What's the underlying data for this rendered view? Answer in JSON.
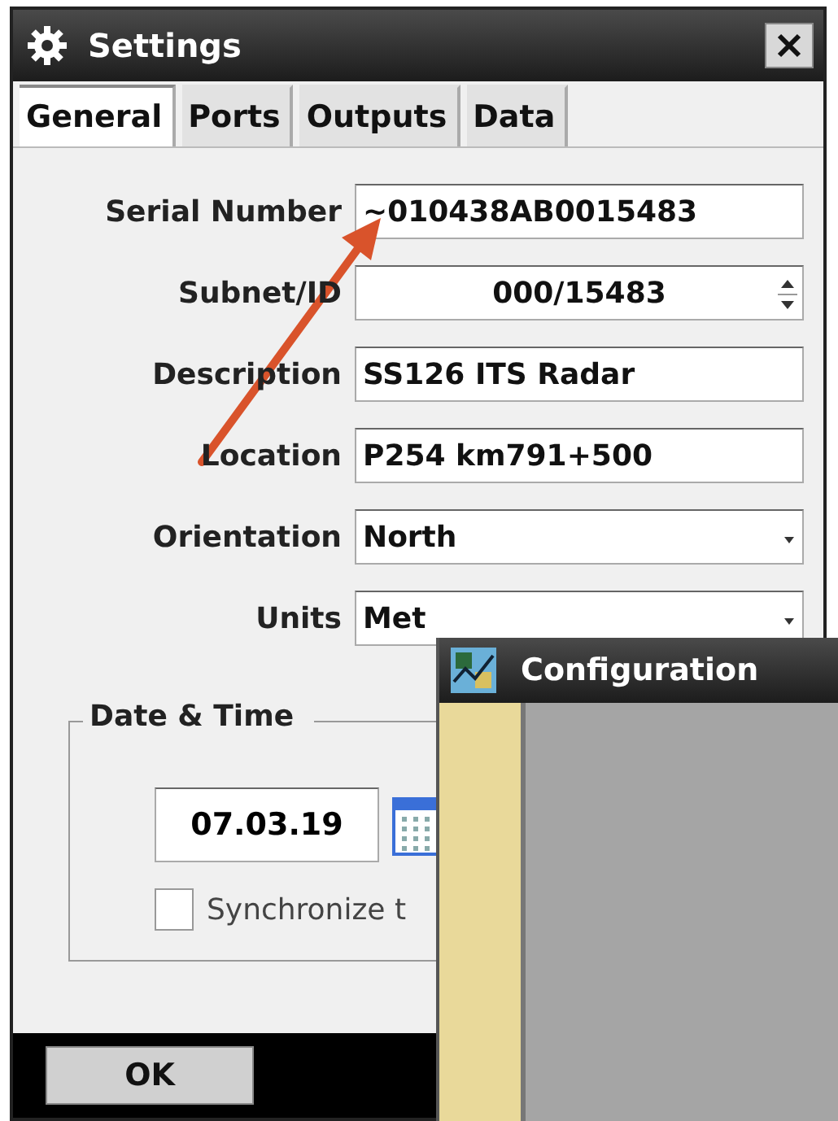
{
  "window": {
    "title": "Settings"
  },
  "tabs": [
    {
      "label": "General",
      "selected": true
    },
    {
      "label": "Ports",
      "selected": false
    },
    {
      "label": "Outputs",
      "selected": false
    },
    {
      "label": "Data",
      "selected": false
    }
  ],
  "fields": [
    {
      "kind": "text",
      "label": "Serial Number",
      "value": "~010438AB0015483"
    },
    {
      "kind": "spinner",
      "label": "Subnet/ID",
      "value": "000/15483"
    },
    {
      "kind": "text",
      "label": "Description",
      "value": "SS126 ITS Radar"
    },
    {
      "kind": "text",
      "label": "Location",
      "value": "P254 km791+500"
    },
    {
      "kind": "dropdown",
      "label": "Orientation",
      "value": "North"
    },
    {
      "kind": "dropdown",
      "label": "Units",
      "value": "Met"
    }
  ],
  "date_time": {
    "title": "Date & Time",
    "date": "07.03.19",
    "sync": {
      "label": "Synchronize t",
      "checked": false
    }
  },
  "buttons": [
    {
      "label": "OK"
    }
  ],
  "overlay_window": {
    "title": "Configuration"
  }
}
